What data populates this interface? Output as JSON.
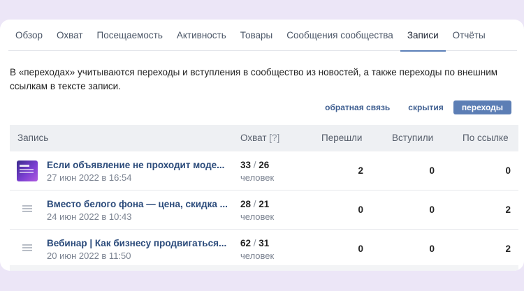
{
  "tabs": [
    {
      "label": "Обзор",
      "active": false
    },
    {
      "label": "Охват",
      "active": false
    },
    {
      "label": "Посещаемость",
      "active": false
    },
    {
      "label": "Активность",
      "active": false
    },
    {
      "label": "Товары",
      "active": false
    },
    {
      "label": "Сообщения сообщества",
      "active": false
    },
    {
      "label": "Записи",
      "active": true
    },
    {
      "label": "Отчёты",
      "active": false
    }
  ],
  "info_text": "В «переходах» учитываются переходы и вступления в сообщество из новостей, а также переходы по внешним ссылкам в тексте записи.",
  "filters": {
    "feedback": "обратная связь",
    "hidden": "скрытия",
    "clicks": "переходы"
  },
  "table": {
    "headers": {
      "post": "Запись",
      "reach": "Охват",
      "reach_hint": "[?]",
      "clicked": "Перешли",
      "joined": "Вступили",
      "by_link": "По ссылке"
    },
    "rows": [
      {
        "title": "Если объявление не проходит моде...",
        "date": "27 июн 2022 в 16:54",
        "reach_a": "33",
        "reach_b": "26",
        "unit": "человек",
        "clicked": "2",
        "joined": "0",
        "by_link": "0",
        "icon": "image-thumbnail"
      },
      {
        "title": "Вместо белого фона — цена, скидка ...",
        "date": "24 июн 2022 в 10:43",
        "reach_a": "28",
        "reach_b": "21",
        "unit": "человек",
        "clicked": "0",
        "joined": "0",
        "by_link": "2",
        "icon": "text-lines-icon"
      },
      {
        "title": "Вебинар | Как бизнесу продвигаться...",
        "date": "20 июн 2022 в 11:50",
        "reach_a": "62",
        "reach_b": "31",
        "unit": "человек",
        "clicked": "0",
        "joined": "0",
        "by_link": "2",
        "icon": "text-lines-icon"
      }
    ]
  },
  "colors": {
    "accent": "#5c7eb5",
    "link": "#2a4a7a",
    "background": "#ece6f7"
  }
}
